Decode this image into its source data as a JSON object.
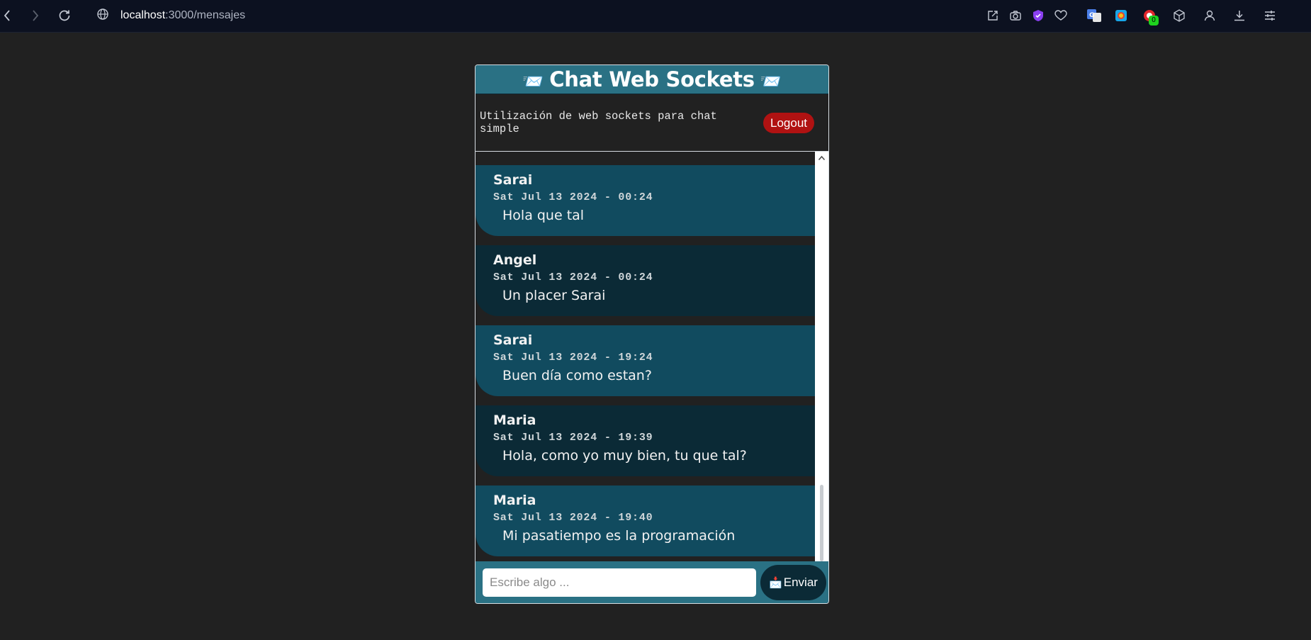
{
  "browser": {
    "url_host": "localhost",
    "url_path": ":3000/mensajes",
    "extension_badge": "0"
  },
  "header": {
    "title": "Chat Web Sockets",
    "emoji": "📨"
  },
  "subheader": {
    "description": "Utilización de web sockets para chat simple",
    "logout_label": "Logout"
  },
  "messages": [
    {
      "sender": "Sarai",
      "date": "Sat Jul 13 2024 - 00:24",
      "text": "Hola que tal"
    },
    {
      "sender": "Angel",
      "date": "Sat Jul 13 2024 - 00:24",
      "text": "Un placer Sarai"
    },
    {
      "sender": "Sarai",
      "date": "Sat Jul 13 2024 - 19:24",
      "text": "Buen día como estan?"
    },
    {
      "sender": "Maria",
      "date": "Sat Jul 13 2024 - 19:39",
      "text": "Hola, como yo muy bien, tu que tal?"
    },
    {
      "sender": "Maria",
      "date": "Sat Jul 13 2024 - 19:40",
      "text": "Mi pasatiempo es la programación"
    }
  ],
  "composer": {
    "placeholder": "Escribe algo ...",
    "value": "",
    "send_icon": "📩",
    "send_label": "Enviar"
  },
  "colors": {
    "page_background": "#212121",
    "header_teal": "#2a7184",
    "message_light": "#114b5f",
    "message_dark": "#0b2a36",
    "logout_red": "#b01212"
  }
}
